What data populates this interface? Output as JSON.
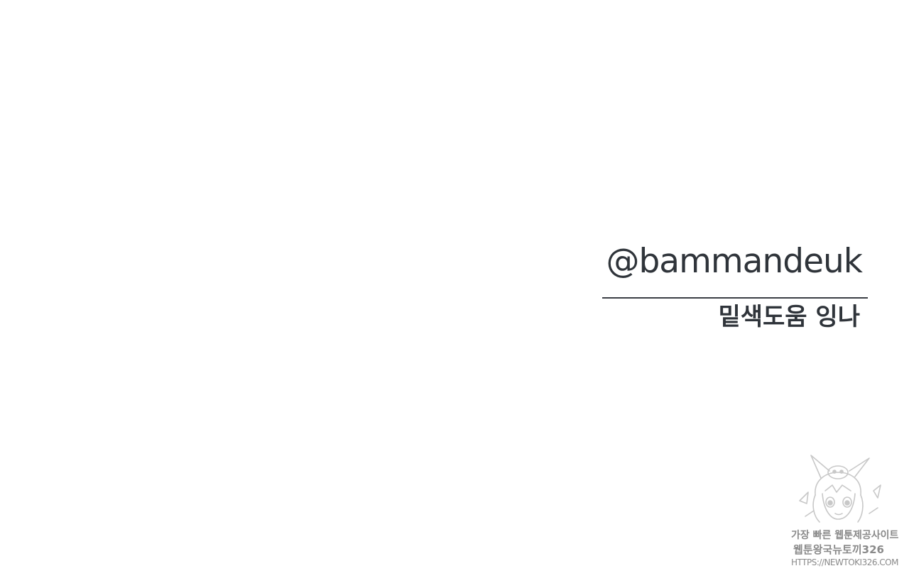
{
  "credit": {
    "handle": "@bammandeuk",
    "role": "밑색도움 잉나"
  },
  "watermark": {
    "line1": "가장 빠른 웹툰제공사이트",
    "line2": "웹툰왕국뉴토끼326",
    "line3": "HTTPS://NEWTOKI326.COM",
    "color": "#8c8c8c"
  }
}
